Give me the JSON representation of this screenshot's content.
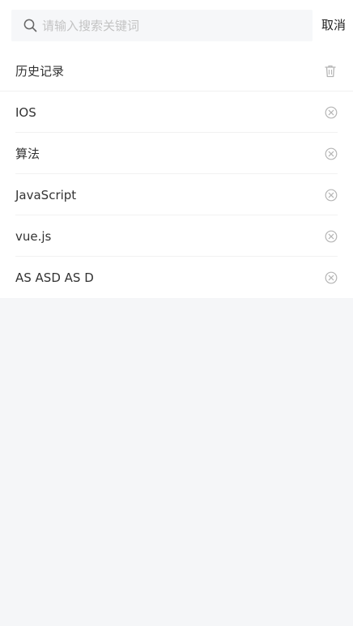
{
  "search": {
    "placeholder": "请输入搜索关键词",
    "value": "",
    "cancel_label": "取消",
    "icon": "search-icon"
  },
  "history": {
    "title": "历史记录",
    "clear_icon": "trash-icon",
    "remove_icon": "close-circle-icon",
    "items": [
      {
        "label": "IOS"
      },
      {
        "label": "算法"
      },
      {
        "label": "JavaScript"
      },
      {
        "label": "vue.js"
      },
      {
        "label": "AS ASD AS D"
      }
    ]
  },
  "colors": {
    "background": "#f5f6f8",
    "surface": "#ffffff",
    "search_field": "#f6f7f9",
    "text": "#333333",
    "placeholder": "#c3c3c3",
    "icon": "#b5b5b5"
  }
}
